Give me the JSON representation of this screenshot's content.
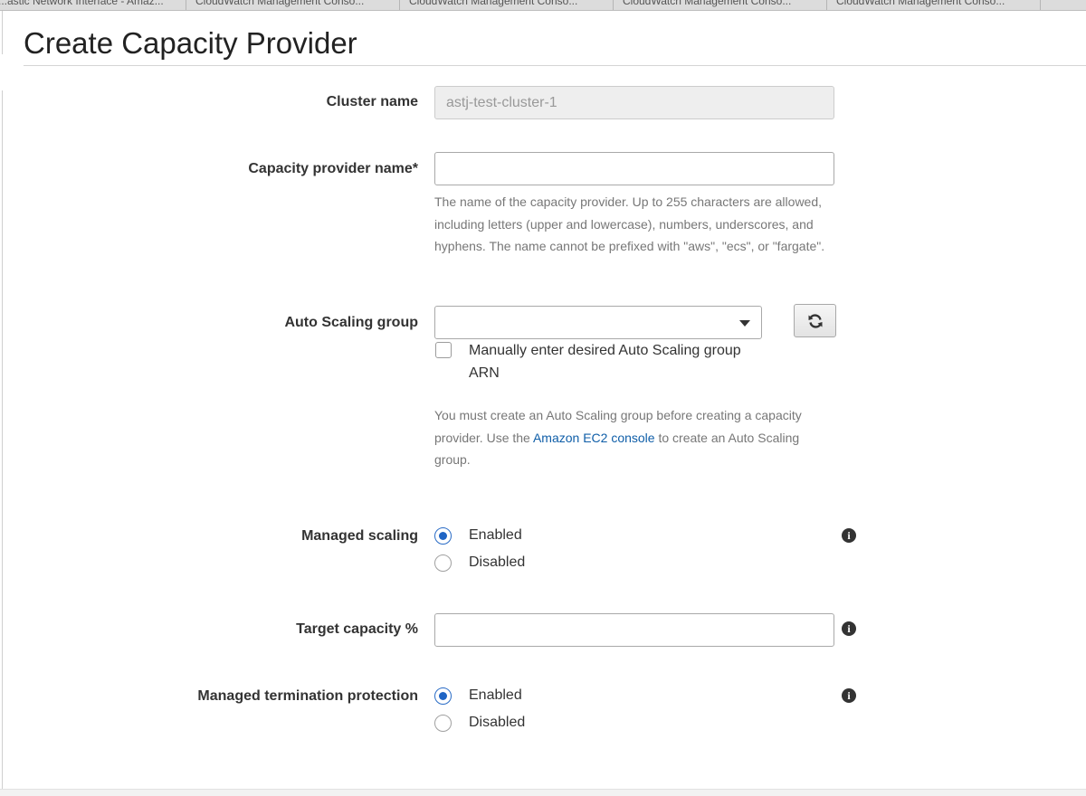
{
  "browser_tabs": [
    "...astic Network Interface - Amaz...",
    "CloudWatch Management Conso...",
    "CloudWatch Management Conso...",
    "CloudWatch Management Conso...",
    "CloudWatch Management Conso..."
  ],
  "page": {
    "title": "Create Capacity Provider"
  },
  "form": {
    "cluster_name": {
      "label": "Cluster name",
      "value": "astj-test-cluster-1"
    },
    "capacity_provider_name": {
      "label": "Capacity provider name*",
      "value": "",
      "help": "The name of the capacity provider. Up to 255 characters are allowed, including letters (upper and lowercase), numbers, underscores, and hyphens. The name cannot be prefixed with \"aws\", \"ecs\", or \"fargate\"."
    },
    "auto_scaling_group": {
      "label": "Auto Scaling group",
      "selected": "",
      "manual_checkbox_label": "Manually enter desired Auto Scaling group ARN",
      "manual_checked": false,
      "help_before": "You must create an Auto Scaling group before creating a capacity provider. Use the ",
      "help_link": "Amazon EC2 console",
      "help_after": " to create an Auto Scaling group."
    },
    "managed_scaling": {
      "label": "Managed scaling",
      "options": [
        "Enabled",
        "Disabled"
      ],
      "selected": "Enabled"
    },
    "target_capacity": {
      "label": "Target capacity %",
      "value": ""
    },
    "managed_termination_protection": {
      "label": "Managed termination protection",
      "options": [
        "Enabled",
        "Disabled"
      ],
      "selected": "Enabled"
    }
  },
  "icons": {
    "refresh": "refresh-icon",
    "info": "info-icon",
    "dropdown": "caret-down-icon"
  },
  "colors": {
    "link": "#0f5ea8",
    "radio_selected": "#1f64c4"
  }
}
